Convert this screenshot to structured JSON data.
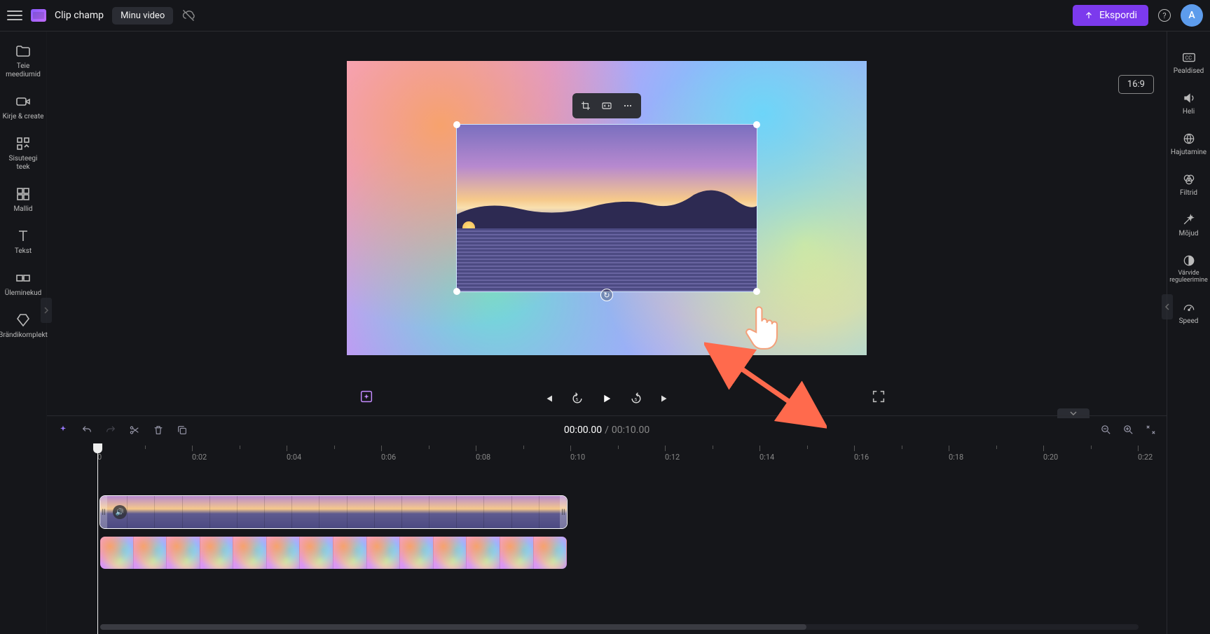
{
  "header": {
    "app_name": "Clip champ",
    "doc_name": "Minu video",
    "export_label": "Ekspordi",
    "avatar_letter": "A",
    "ratio_label": "16:9"
  },
  "left_rail": [
    {
      "id": "media",
      "label": "Teie meediumid"
    },
    {
      "id": "record",
      "label": "Kirje &amp; create"
    },
    {
      "id": "content",
      "label": "Sisuteegi teek"
    },
    {
      "id": "templates",
      "label": "Mallid"
    },
    {
      "id": "text",
      "label": "Tekst"
    },
    {
      "id": "transitions",
      "label": "Üleminekud"
    },
    {
      "id": "brand",
      "label": "Brändikomplekt"
    }
  ],
  "right_rail": [
    {
      "id": "captions",
      "label": "Pealdised"
    },
    {
      "id": "audio",
      "label": "Heli"
    },
    {
      "id": "fade",
      "label": "Hajutamine"
    },
    {
      "id": "filters",
      "label": "Filtrid"
    },
    {
      "id": "effects",
      "label": "Mõjud"
    },
    {
      "id": "colors",
      "label": "Värvide reguleerimine"
    },
    {
      "id": "speed",
      "label": "Speed"
    }
  ],
  "timecode": {
    "current": "00:00.00",
    "separator": "/",
    "total": "00:10.00"
  },
  "ruler_ticks": [
    "0",
    "0:02",
    "0:04",
    "0:06",
    "0:08",
    "0:10",
    "0:12",
    "0:14",
    "0:16",
    "0:18",
    "0:20",
    "0:22"
  ],
  "selection_toolbar": {
    "crop": "crop",
    "fit": "fit",
    "more": "more"
  }
}
